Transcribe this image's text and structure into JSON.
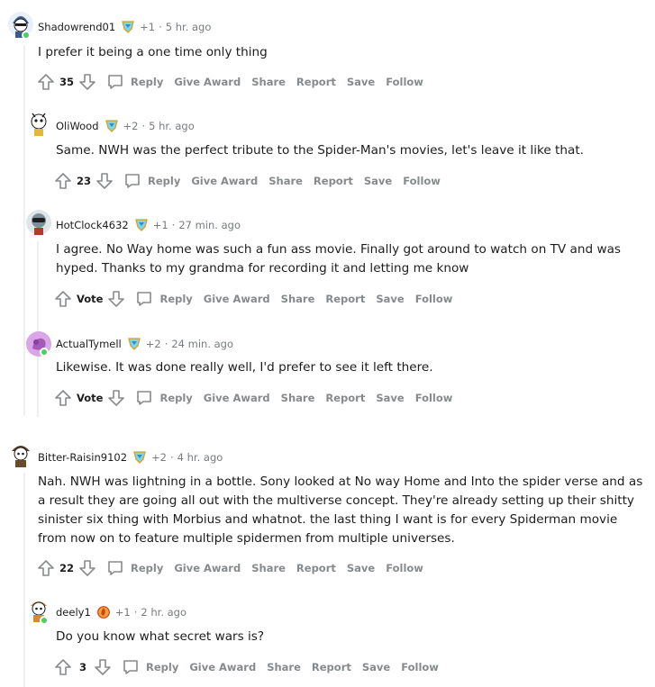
{
  "actions": {
    "reply": "Reply",
    "give_award": "Give Award",
    "share": "Share",
    "report": "Report",
    "save": "Save",
    "follow": "Follow"
  },
  "colors": {
    "online": "#46d160",
    "meta_text": "#787c7e",
    "action_text": "#878a8c",
    "thread_line": "#edeff1"
  },
  "comments": [
    {
      "username": "Shadowrend01",
      "award_icon": "helpful-award-icon",
      "plus": "+1",
      "time": "5 hr. ago",
      "body": "I prefer it being a one time only thing",
      "score": "35"
    },
    {
      "username": "OliWood",
      "award_icon": "helpful-award-icon",
      "plus": "+2",
      "time": "5 hr. ago",
      "body": "Same. NWH was the perfect tribute to the Spider-Man's movies, let's leave it like that.",
      "score": "23"
    },
    {
      "username": "HotClock4632",
      "award_icon": "helpful-award-icon",
      "plus": "+1",
      "time": "27 min. ago",
      "body": "I agree. No Way home was such a fun ass movie. Finally got around to watch on TV and was hyped. Thanks to my grandma for recording it and letting me know",
      "score": "Vote"
    },
    {
      "username": "ActualTymell",
      "award_icon": "helpful-award-icon",
      "plus": "+2",
      "time": "24 min. ago",
      "body": "Likewise. It was done really well, I'd prefer to see it left there.",
      "score": "Vote"
    },
    {
      "username": "Bitter-Raisin9102",
      "award_icon": "helpful-award-icon",
      "plus": "+2",
      "time": "4 hr. ago",
      "body": "Nah. NWH was lightning in a bottle. Sony looked at No way Home and Into the spider verse and as a result they are going all out with the multiverse concept. They're already setting up their shitty sinister six thing with Morbius and whatnot. the last thing I want is for every Spiderman movie from now on to feature multiple spidermen from multiple universes.",
      "score": "22"
    },
    {
      "username": "deely1",
      "award_icon": "fire-award-icon",
      "plus": "+1",
      "time": "2 hr. ago",
      "body": "Do you know what secret wars is?",
      "score": "3"
    }
  ]
}
